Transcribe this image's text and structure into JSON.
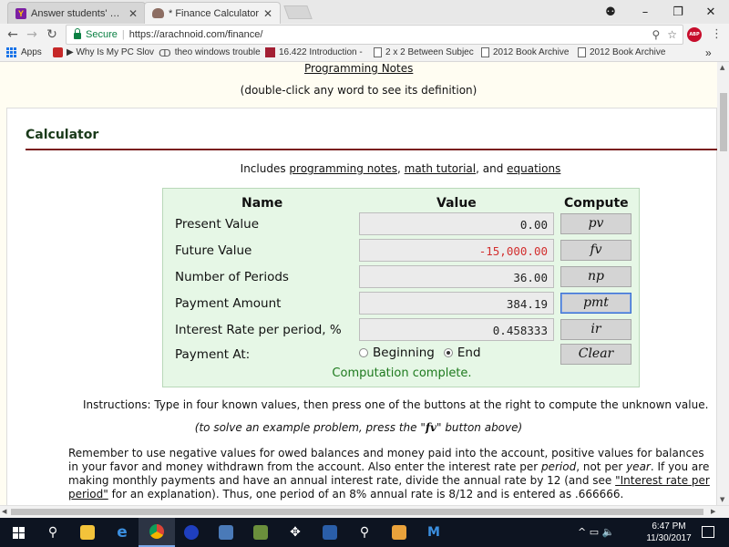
{
  "browser": {
    "tabs": [
      {
        "title": "Answer students' questic",
        "favicon": "yellow-y-favicon"
      },
      {
        "title": "* Finance Calculator",
        "favicon": "finance-favicon"
      }
    ],
    "window_controls": {
      "account": "⚉",
      "minimize": "–",
      "restore": "❐",
      "close": "✕"
    },
    "address": {
      "secure_label": "Secure",
      "url": "https://arachnoid.com/finance/"
    },
    "bookmarks": [
      {
        "label": "Apps",
        "icon": "apps-icon"
      },
      {
        "label": "▶ Why Is My PC Slov",
        "icon": "power-icon"
      },
      {
        "label": "theo windows trouble",
        "icon": "theo-icon"
      },
      {
        "label": "16.422 Introduction -",
        "icon": "mit-icon"
      },
      {
        "label": "2 x 2 Between Subjec",
        "icon": "file-icon"
      },
      {
        "label": "2012 Book Archive",
        "icon": "file-icon"
      },
      {
        "label": "2012 Book Archive",
        "icon": "file-icon"
      }
    ],
    "bookmarks_overflow": "»"
  },
  "page": {
    "top_link": "Programming Notes",
    "dblclick_hint": "(double-click any word to see its definition)",
    "section_title": "Calculator",
    "includes": {
      "prefix": "Includes ",
      "link1": "programming notes",
      "comma": ", ",
      "link2": "math tutorial",
      "and": ", and ",
      "link3": "equations"
    },
    "calculator": {
      "headers": {
        "name": "Name",
        "value": "Value",
        "compute": "Compute"
      },
      "rows": [
        {
          "label": "Present Value",
          "value": "0.00",
          "button": "pv"
        },
        {
          "label": "Future Value",
          "value": "-15,000.00",
          "button": "fv"
        },
        {
          "label": "Number of Periods",
          "value": "36.00",
          "button": "np"
        },
        {
          "label": "Payment Amount",
          "value": "384.19",
          "button": "pmt"
        },
        {
          "label": "Interest Rate per period, %",
          "value": "0.458333",
          "button": "ir"
        }
      ],
      "payment_at": {
        "label": "Payment At:",
        "option_beginning": "Beginning",
        "option_end": "End",
        "selected": "End"
      },
      "clear_button": "Clear",
      "status": "Computation complete.",
      "negative_color": "#d32f2f",
      "status_color": "#1e7a1e"
    },
    "instructions": "Instructions: Type in four known values, then press one of the buttons at the right to compute the unknown value.",
    "example": {
      "prefix": "(to solve an example problem, press the \"",
      "button": "fv",
      "suffix": "\" button above)"
    },
    "paragraph": {
      "part1": "Remember to use negative values for owed balances and money paid into the account, positive values for balances in your favor and money withdrawn from the account. Also enter the interest rate per ",
      "em1": "period",
      "part2": ", not per ",
      "em2": "year",
      "part3": ". If you are making monthly payments and have an annual interest rate, divide the annual rate by 12 (and see ",
      "link": "\"Interest rate per period\"",
      "part4": " for an explanation). Thus, one period of an 8% annual rate is 8/12 and is entered as .666666."
    }
  },
  "taskbar": {
    "items": [
      "start-icon",
      "search-icon",
      "file-explorer-icon",
      "edge-icon",
      "chrome-icon",
      "app-icon",
      "app-icon",
      "app-icon",
      "app-icon",
      "app-icon",
      "app-icon",
      "app-icon",
      "app-icon"
    ],
    "tray": "^ ▭ 🔈",
    "time": "6:47 PM",
    "date": "11/30/2017"
  }
}
